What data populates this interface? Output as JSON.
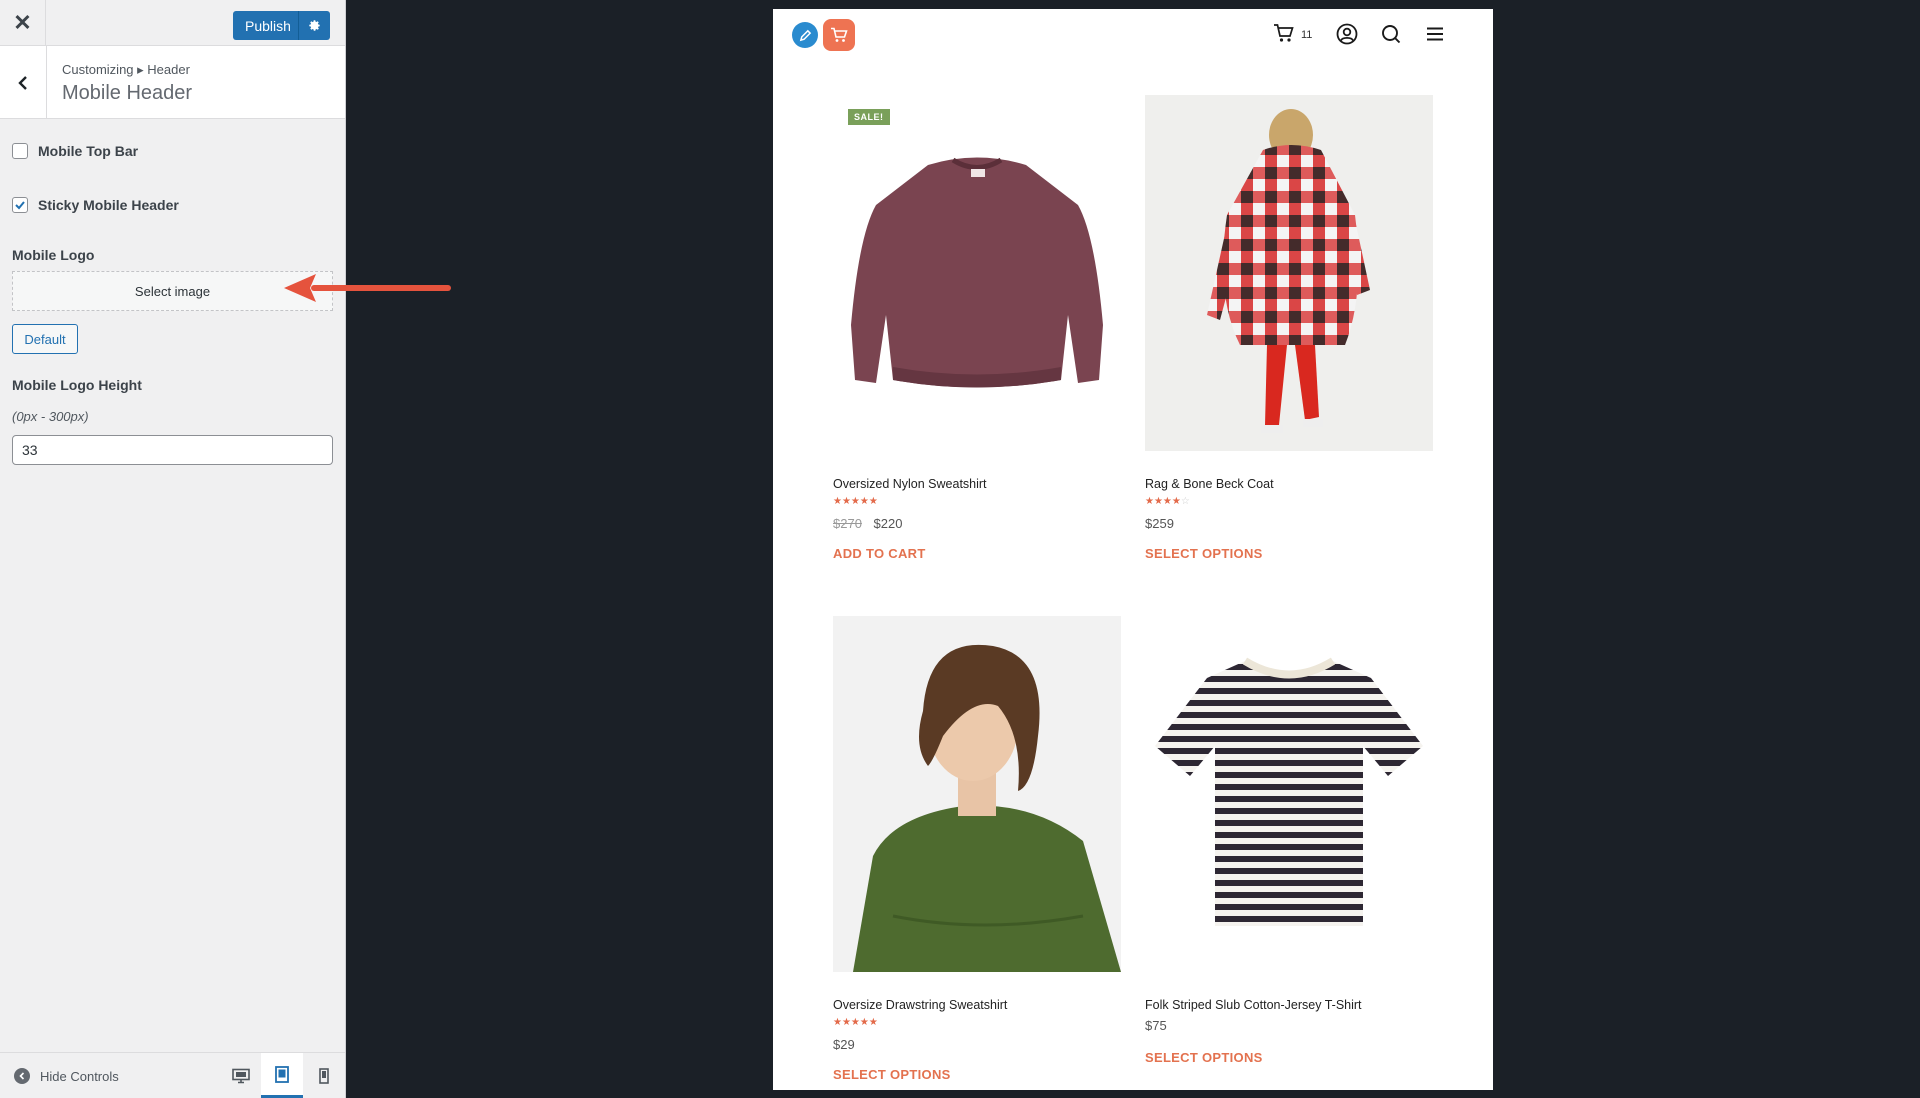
{
  "customizer": {
    "publish_label": "Publish",
    "breadcrumb": "Customizing ▸ Header",
    "section_title": "Mobile Header",
    "controls": {
      "top_bar_label": "Mobile Top Bar",
      "top_bar_checked": false,
      "sticky_label": "Sticky Mobile Header",
      "sticky_checked": true,
      "logo_label": "Mobile Logo",
      "select_image_label": "Select image",
      "default_label": "Default",
      "logo_height_label": "Mobile Logo Height",
      "logo_height_range": "(0px - 300px)",
      "logo_height_value": "33"
    },
    "footer": {
      "hide_controls_label": "Hide Controls",
      "active_device": "tablet"
    },
    "accent_color": "#2271b1"
  },
  "annotation": {
    "arrow_color": "#e5533d"
  },
  "preview": {
    "cart_count": "11",
    "products": [
      {
        "name": "Oversized Nylon Sweatshirt",
        "rating": 5,
        "old_price": "$270",
        "price": "$220",
        "sale_badge": "SALE!",
        "cta": "ADD TO CART"
      },
      {
        "name": "Rag & Bone Beck Coat",
        "rating": 4,
        "old_price": "",
        "price": "$259",
        "sale_badge": "",
        "cta": "SELECT OPTIONS"
      },
      {
        "name": "Oversize Drawstring Sweatshirt",
        "rating": 5,
        "old_price": "",
        "price": "$29",
        "sale_badge": "",
        "cta": "SELECT OPTIONS"
      },
      {
        "name": "Folk Striped Slub Cotton-Jersey T-Shirt",
        "rating": 0,
        "old_price": "",
        "price": "$75",
        "sale_badge": "",
        "cta": "SELECT OPTIONS"
      }
    ],
    "accent_color": "#e3724f"
  }
}
